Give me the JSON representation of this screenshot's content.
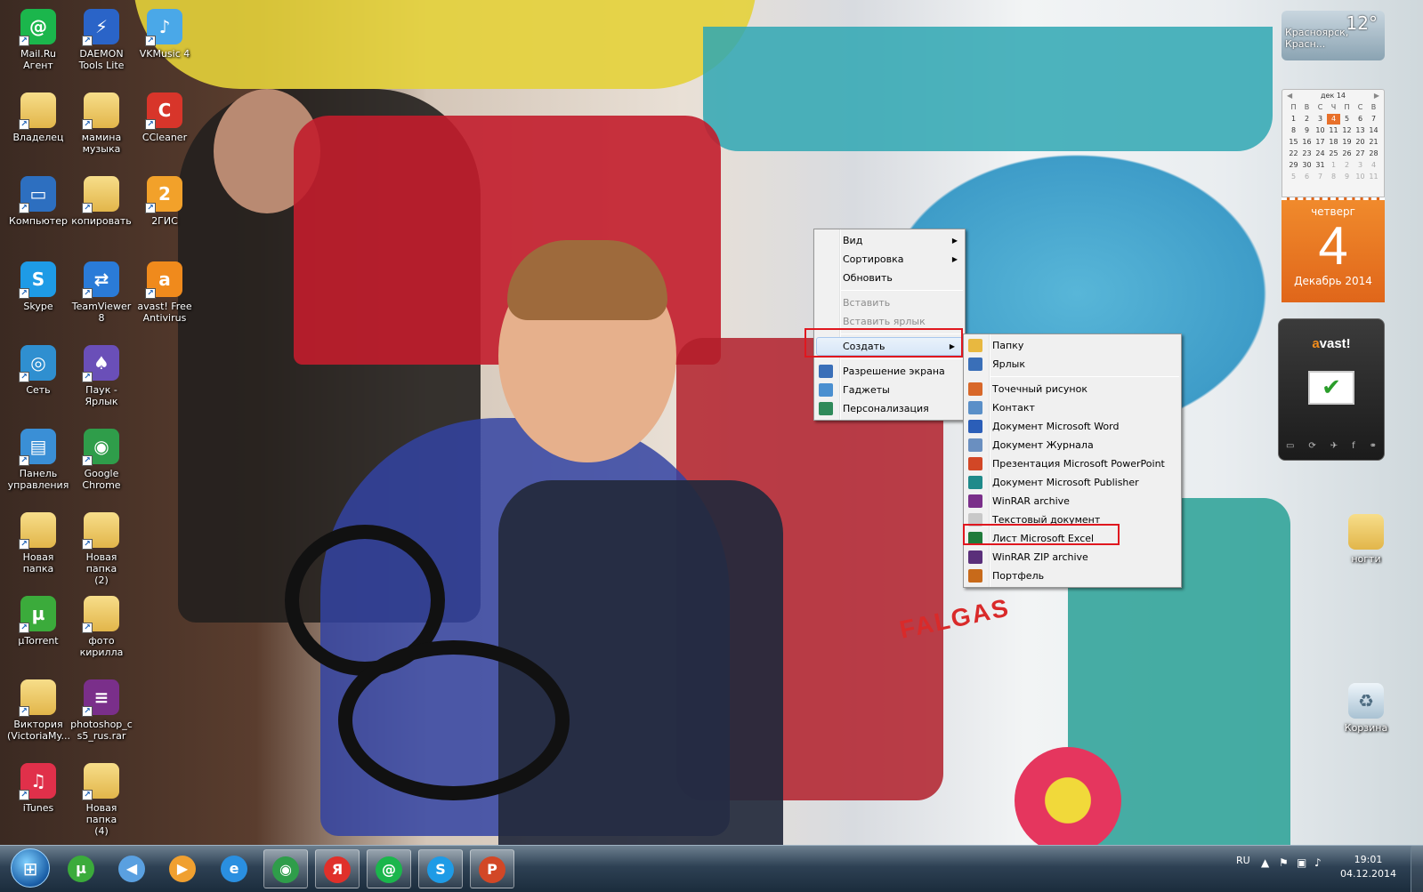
{
  "desktop_icons": [
    {
      "label": "Mail.Ru\nАгент",
      "icon": "mailru-agent-icon",
      "glyph": "@",
      "color": "#1bb64c"
    },
    {
      "label": "DAEMON\nTools Lite",
      "icon": "daemon-tools-icon",
      "glyph": "⚡",
      "color": "#2a64c8"
    },
    {
      "label": "VKMusic 4",
      "icon": "vkmusic-icon",
      "glyph": "♪",
      "color": "#4aa8e8"
    },
    {
      "label": "Владелец",
      "icon": "user-folder-icon",
      "glyph": "",
      "color": "folder"
    },
    {
      "label": "мамина\nмузыка",
      "icon": "folder-icon",
      "glyph": "",
      "color": "folder"
    },
    {
      "label": "CCleaner",
      "icon": "ccleaner-icon",
      "glyph": "C",
      "color": "#d8352a"
    },
    {
      "label": "Компьютер",
      "icon": "computer-icon",
      "glyph": "▭",
      "color": "#2d6fc0"
    },
    {
      "label": "копировать",
      "icon": "folder-icon",
      "glyph": "",
      "color": "folder"
    },
    {
      "label": "2ГИС",
      "icon": "2gis-icon",
      "glyph": "2",
      "color": "#f2a12a"
    },
    {
      "label": "Skype",
      "icon": "skype-icon",
      "glyph": "S",
      "color": "#1e9be6"
    },
    {
      "label": "TeamViewer\n8",
      "icon": "teamviewer-icon",
      "glyph": "⇄",
      "color": "#2a7bd8"
    },
    {
      "label": "avast! Free\nAntivirus",
      "icon": "avast-icon",
      "glyph": "a",
      "color": "#f08a1c"
    },
    {
      "label": "Сеть",
      "icon": "network-icon",
      "glyph": "◎",
      "color": "#2f8fd0"
    },
    {
      "label": "Паук -\nЯрлык",
      "icon": "spider-solitaire-icon",
      "glyph": "♠",
      "color": "#6a4fb8"
    },
    {
      "label": "Панель\nуправления",
      "icon": "control-panel-icon",
      "glyph": "▤",
      "color": "#3a8fd6"
    },
    {
      "label": "Google\nChrome",
      "icon": "chrome-icon",
      "glyph": "◉",
      "color": "#2f9d4a"
    },
    {
      "label": "Новая папка",
      "icon": "folder-icon",
      "glyph": "",
      "color": "folder"
    },
    {
      "label": "Новая папка\n(2)",
      "icon": "folder-icon",
      "glyph": "",
      "color": "folder"
    },
    {
      "label": "µTorrent",
      "icon": "utorrent-icon",
      "glyph": "µ",
      "color": "#3bab3b"
    },
    {
      "label": "фото\nкирилла",
      "icon": "folder-icon",
      "glyph": "",
      "color": "folder"
    },
    {
      "label": "Виктория\n(VictoriaMy...",
      "icon": "folder-icon",
      "glyph": "",
      "color": "folder"
    },
    {
      "label": "photoshop_c\ns5_rus.rar",
      "icon": "winrar-archive-icon",
      "glyph": "≡",
      "color": "#7a2f8a"
    },
    {
      "label": "iTunes",
      "icon": "itunes-icon",
      "glyph": "♫",
      "color": "#e0304a"
    },
    {
      "label": "Новая папка\n(4)",
      "icon": "folder-icon",
      "glyph": "",
      "color": "folder"
    }
  ],
  "right_icons": [
    {
      "label": "ногти",
      "icon": "folder-icon"
    },
    {
      "label": "Корзина",
      "icon": "recycle-bin-icon"
    }
  ],
  "weather": {
    "temp": "12°",
    "city": "Красноярск, Красн..."
  },
  "calendar": {
    "month_label": "дек 14",
    "weekdays": [
      "П",
      "В",
      "С",
      "Ч",
      "П",
      "С",
      "В"
    ],
    "weeks": [
      [
        "1",
        "2",
        "3",
        "4",
        "5",
        "6",
        "7"
      ],
      [
        "8",
        "9",
        "10",
        "11",
        "12",
        "13",
        "14"
      ],
      [
        "15",
        "16",
        "17",
        "18",
        "19",
        "20",
        "21"
      ],
      [
        "22",
        "23",
        "24",
        "25",
        "26",
        "27",
        "28"
      ],
      [
        "29",
        "30",
        "31",
        "1",
        "2",
        "3",
        "4"
      ],
      [
        "5",
        "6",
        "7",
        "8",
        "9",
        "10",
        "11"
      ]
    ],
    "today": "4",
    "day_of_week": "четверг",
    "day_number": "4",
    "month_year": "Декабрь 2014"
  },
  "avast_gadget": {
    "logo_a": "a",
    "logo_rest": "vast!"
  },
  "context_menu": {
    "items": [
      {
        "label": "Вид",
        "submenu": true,
        "disabled": false,
        "icon": ""
      },
      {
        "label": "Сортировка",
        "submenu": true,
        "disabled": false,
        "icon": ""
      },
      {
        "label": "Обновить",
        "submenu": false,
        "disabled": false,
        "icon": ""
      },
      {
        "sep": true
      },
      {
        "label": "Вставить",
        "submenu": false,
        "disabled": true,
        "icon": ""
      },
      {
        "label": "Вставить ярлык",
        "submenu": false,
        "disabled": true,
        "icon": ""
      },
      {
        "sep": true
      },
      {
        "label": "Создать",
        "submenu": true,
        "disabled": false,
        "icon": "",
        "hover": true
      },
      {
        "sep": true
      },
      {
        "label": "Разрешение экрана",
        "submenu": false,
        "disabled": false,
        "icon": "screen-resolution-icon"
      },
      {
        "label": "Гаджеты",
        "submenu": false,
        "disabled": false,
        "icon": "gadgets-icon"
      },
      {
        "label": "Персонализация",
        "submenu": false,
        "disabled": false,
        "icon": "personalization-icon"
      }
    ]
  },
  "create_submenu": {
    "items": [
      {
        "label": "Папку",
        "icon": "folder-icon",
        "color": "#e8b840"
      },
      {
        "label": "Ярлык",
        "icon": "shortcut-icon",
        "color": "#3a6fb8"
      },
      {
        "sep": true
      },
      {
        "label": "Точечный рисунок",
        "icon": "bitmap-icon",
        "color": "#d8682a"
      },
      {
        "label": "Контакт",
        "icon": "contact-icon",
        "color": "#5a8fc8"
      },
      {
        "label": "Документ Microsoft Word",
        "icon": "word-icon",
        "color": "#2b5eb8"
      },
      {
        "label": "Документ Журнала",
        "icon": "journal-icon",
        "color": "#6a8fc0"
      },
      {
        "label": "Презентация Microsoft PowerPoint",
        "icon": "powerpoint-icon",
        "color": "#d24726"
      },
      {
        "label": "Документ Microsoft Publisher",
        "icon": "publisher-icon",
        "color": "#1f8a8a"
      },
      {
        "label": "WinRAR archive",
        "icon": "winrar-icon",
        "color": "#7a2f8a"
      },
      {
        "label": "Текстовый документ",
        "icon": "text-document-icon",
        "color": "#c8c8c8"
      },
      {
        "label": "Лист Microsoft Excel",
        "icon": "excel-icon",
        "color": "#1f7a3a",
        "highlighted": true
      },
      {
        "label": "WinRAR ZIP archive",
        "icon": "winrar-zip-icon",
        "color": "#5a2f7a"
      },
      {
        "label": "Портфель",
        "icon": "briefcase-icon",
        "color": "#c86a1a"
      }
    ]
  },
  "taskbar": {
    "buttons": [
      {
        "name": "utorrent",
        "icon": "utorrent-icon",
        "glyph": "µ",
        "color": "#3bab3b"
      },
      {
        "name": "volume-app",
        "icon": "speaker-icon",
        "glyph": "◀",
        "color": "#5aa0e0"
      },
      {
        "name": "media-player",
        "icon": "media-player-icon",
        "glyph": "▶",
        "color": "#f0a030"
      },
      {
        "name": "internet-explorer",
        "icon": "internet-explorer-icon",
        "glyph": "e",
        "color": "#2a8fe0"
      },
      {
        "name": "chrome",
        "icon": "chrome-icon",
        "glyph": "◉",
        "color": "#2f9d4a",
        "active": true
      },
      {
        "name": "yandex",
        "icon": "yandex-icon",
        "glyph": "Я",
        "color": "#e0302a",
        "active": true
      },
      {
        "name": "mailru-agent",
        "icon": "mailru-agent-icon",
        "glyph": "@",
        "color": "#1bb64c",
        "active": true
      },
      {
        "name": "skype",
        "icon": "skype-icon",
        "glyph": "S",
        "color": "#1e9be6",
        "active": true
      },
      {
        "name": "powerpoint",
        "icon": "powerpoint-icon",
        "glyph": "P",
        "color": "#d24726",
        "active": true
      }
    ],
    "tray": {
      "lang": "RU",
      "time": "19:01",
      "date": "04.12.2014"
    }
  }
}
